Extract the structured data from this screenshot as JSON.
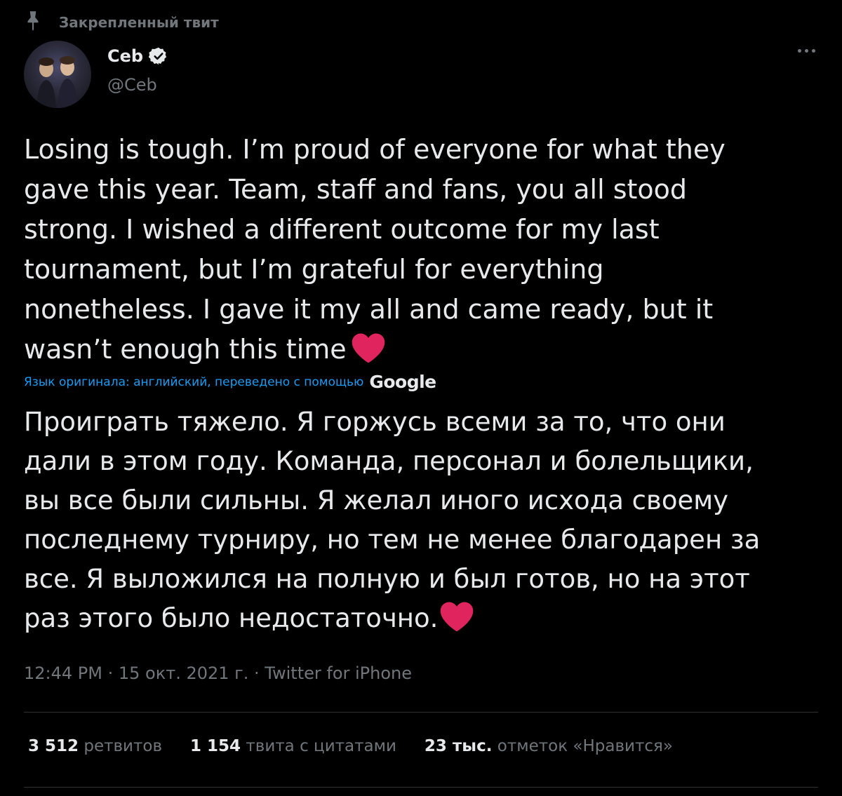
{
  "pinned": {
    "label": "Закрепленный твит",
    "icon": "pin-icon"
  },
  "author": {
    "name": "Ceb",
    "handle": "@Ceb",
    "verified": true,
    "verified_icon": "verified-badge-icon"
  },
  "tweet": {
    "original_text": "Losing is tough. I’m proud of everyone for what they\ngave this year. Team, staff and fans, you all stood\nstrong. I wished a different outcome for my last\ntournament, but I’m grateful for everything\nnonetheless. I gave it my all and came ready, but it\nwasn’t enough this time",
    "original_emoji": "heart-emoji",
    "translation_note": "Язык оригинала: английский, переведено с помощью",
    "translation_provider": "Google",
    "translated_text": "Проиграть тяжело. Я горжусь всеми за то, что они\nдали в этом году. Команда, персонал и болельщики,\nвы все были сильны. Я желал иного исхода своему\nпоследнему турниру, но тем не менее благодарен за\nвсе. Я выложился на полную и был готов, но на этот\nраз этого было недостаточно.",
    "time": "12:44 PM",
    "date": "15 окт. 2021 г.",
    "source": "Twitter for iPhone",
    "separator": " · "
  },
  "stats": {
    "retweets_count": "3 512",
    "retweets_label": "ретвитов",
    "quotes_count": "1 154",
    "quotes_label": "твита с цитатами",
    "likes_count": "23 тыс.",
    "likes_label": "отметок «Нравится»"
  },
  "colors": {
    "background": "#000000",
    "text": "#e7e9ea",
    "secondary": "#71767b",
    "link": "#1d9bf0",
    "heart": "#e0245e"
  }
}
